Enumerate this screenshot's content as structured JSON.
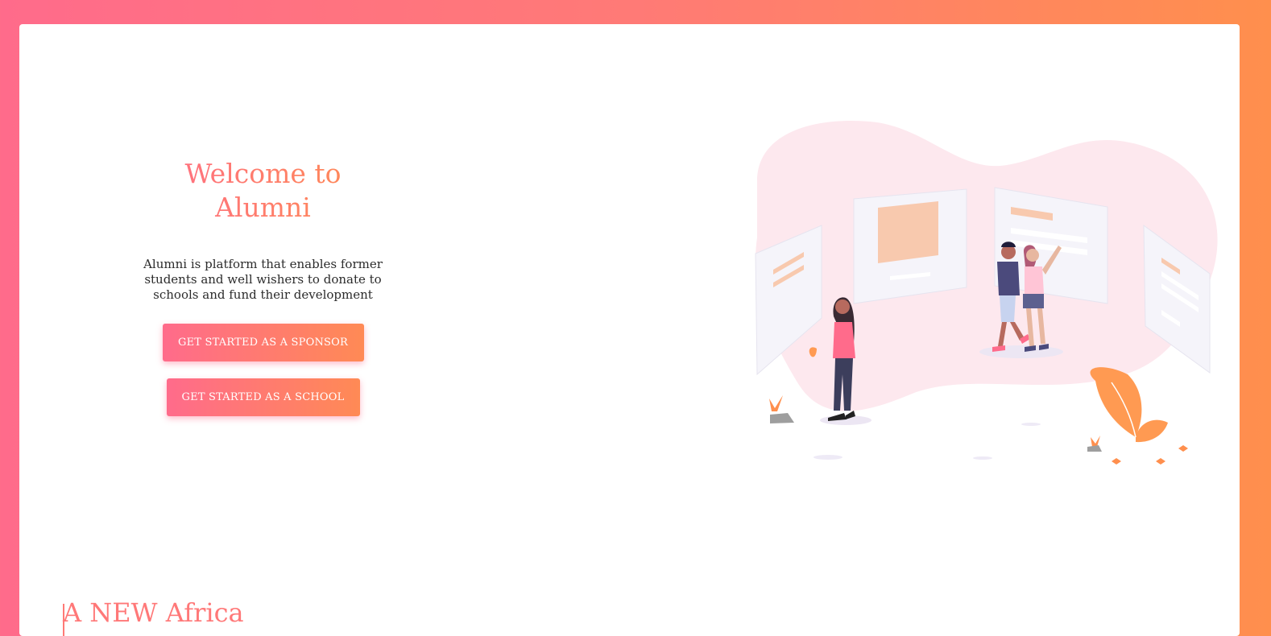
{
  "hero": {
    "title_line1": "Welcome to",
    "title_line2": "Alumni",
    "description": "Alumni is platform that enables former students and well wishers to donate to schools and fund their development",
    "sponsor_button": "GET STARTED AS A SPONSOR",
    "school_button": "GET STARTED AS A SCHOOL"
  },
  "section": {
    "title": "A NEW Africa"
  },
  "illustration": {
    "name": "people-viewing-panels-illustration"
  },
  "colors": {
    "gradient_start": "#ff6b8b",
    "gradient_end": "#ff8f4d",
    "blob": "#fde8ee",
    "panel": "#f5f4fa",
    "accent_orange": "#f8c9ae"
  }
}
